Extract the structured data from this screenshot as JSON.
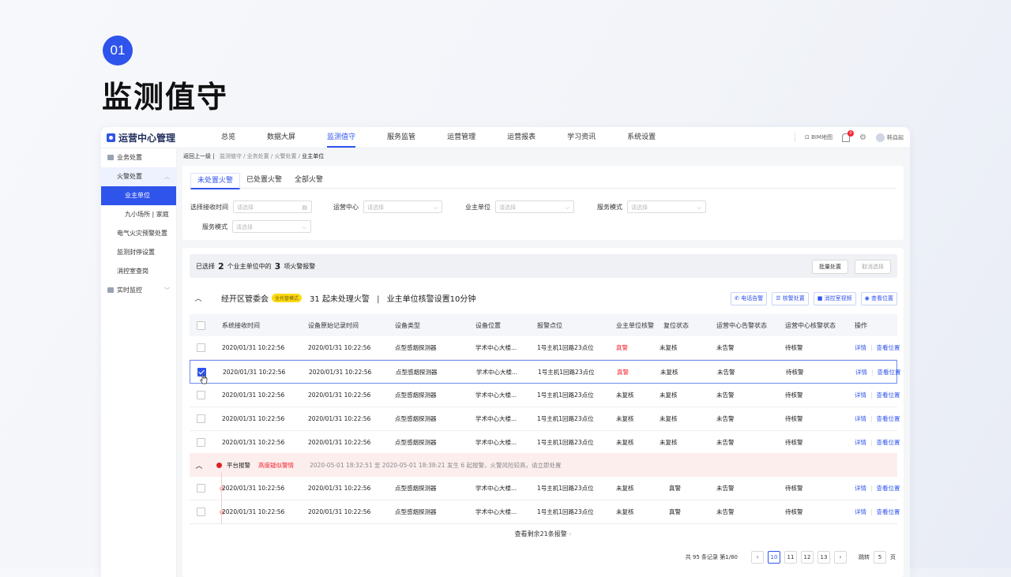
{
  "page": {
    "number": "01",
    "title": "监测值守"
  },
  "topbar": {
    "app_title": "运营中心管理",
    "nav": [
      "总览",
      "数据大屏",
      "监测值守",
      "服务监管",
      "运营管理",
      "运营报表",
      "学习资讯",
      "系统设置"
    ],
    "active_nav": "监测值守",
    "bim_label": "BIM地图",
    "notification_count": "0",
    "user_name": "韩自起"
  },
  "sidebar": {
    "items": [
      {
        "label": "业务处置"
      },
      {
        "label": "火警处置"
      },
      {
        "label": "业主单位"
      },
      {
        "label": "九小场所 | 家庭"
      },
      {
        "label": "电气火灾预警处置"
      },
      {
        "label": "监测封停设置"
      },
      {
        "label": "消控室查岗"
      },
      {
        "label": "实时监控"
      }
    ]
  },
  "breadcrumb": {
    "back": "返回上一级 |",
    "path": "监测值守 / 业务处置 / 火警处置 /",
    "current": "业主单位"
  },
  "tabs": [
    "未处置火警",
    "已处置火警",
    "全部火警"
  ],
  "filters": {
    "receive_time": {
      "label": "选择接收时间",
      "placeholder": "请选择"
    },
    "ops_center": {
      "label": "运营中心",
      "placeholder": "请选择"
    },
    "owner_unit": {
      "label": "业主单位",
      "placeholder": "请选择"
    },
    "service_mode": {
      "label": "服务模式",
      "placeholder": "请选择"
    },
    "service_mode2": {
      "label": "服务模式",
      "placeholder": "请选择"
    }
  },
  "selection": {
    "prefix": "已选择",
    "units": "2",
    "middle": "个业主单位中的",
    "items": "3",
    "suffix": "项火警报警",
    "batch_button": "批量处置",
    "cancel_button": "取消选择"
  },
  "group": {
    "org": "经开区管委会",
    "mode_tag": "全托管模式",
    "pending_count": "31",
    "pending_text": "起未处理火警",
    "divider": "|",
    "setting_text": "业主单位核警设置10分钟",
    "actions": [
      "电话告警",
      "核警处置",
      "消控室视频",
      "查看位置"
    ]
  },
  "table": {
    "headers": [
      "系统接收时间",
      "设备原始记录时间",
      "设备类型",
      "设备位置",
      "报警点位",
      "业主单位核警",
      "复位状态",
      "运营中心告警状态",
      "运营中心核警状态",
      "操作"
    ],
    "rows": [
      {
        "recv": "2020/01/31   10:22:56",
        "orig": "2020/01/31   10:22:56",
        "type": "点型感烟探测器",
        "loc": "学术中心大楼...",
        "point": "1号主机1回路23点位",
        "check": "真警",
        "reset": "未复核",
        "alarm": "未告警",
        "verify": "待核警",
        "checked": false
      },
      {
        "recv": "2020/01/31   10:22:56",
        "orig": "2020/01/31   10:22:56",
        "type": "点型感烟探测器",
        "loc": "学术中心大楼...",
        "point": "1号主机1回路23点位",
        "check": "真警",
        "reset": "未复核",
        "alarm": "未告警",
        "verify": "待核警",
        "checked": true
      },
      {
        "recv": "2020/01/31   10:22:56",
        "orig": "2020/01/31   10:22:56",
        "type": "点型感烟探测器",
        "loc": "学术中心大楼...",
        "point": "1号主机1回路23点位",
        "check": "未复核",
        "reset": "未复核",
        "alarm": "未告警",
        "verify": "待核警",
        "checked": false
      },
      {
        "recv": "2020/01/31   10:22:56",
        "orig": "2020/01/31   10:22:56",
        "type": "点型感烟探测器",
        "loc": "学术中心大楼...",
        "point": "1号主机1回路23点位",
        "check": "未复核",
        "reset": "未复核",
        "alarm": "未告警",
        "verify": "待核警",
        "checked": false
      },
      {
        "recv": "2020/01/31   10:22:56",
        "orig": "2020/01/31   10:22:56",
        "type": "点型感烟探测器",
        "loc": "学术中心大楼...",
        "point": "1号主机1回路23点位",
        "check": "未复核",
        "reset": "未复核",
        "alarm": "未告警",
        "verify": "待核警",
        "checked": false
      }
    ],
    "op_detail": "详情",
    "op_locate": "查看位置"
  },
  "platform_alarm": {
    "label": "平台报警",
    "level": "高度疑似警情",
    "message": "2020-05-01 18:32:51 至 2020-05-01 18:38:21 发生 6 起报警，火警风险较高，请立即处置"
  },
  "sub_rows": [
    {
      "recv": "2020/01/31   10:22:56",
      "orig": "2020/01/31   10:22:56",
      "type": "点型感烟探测器",
      "loc": "学术中心大楼...",
      "point": "1号主机1回路23点位",
      "check": "未复核",
      "reset": "真警",
      "alarm": "未告警",
      "verify": "待核警"
    },
    {
      "recv": "2020/01/31   10:22:56",
      "orig": "2020/01/31   10:22:56",
      "type": "点型感烟探测器",
      "loc": "学术中心大楼...",
      "point": "1号主机1回路23点位",
      "check": "未复核",
      "reset": "真警",
      "alarm": "未告警",
      "verify": "待核警"
    }
  ],
  "more": "查看剩余21条报警",
  "pagination": {
    "total": "共 95 条记录 第1/80",
    "pages": [
      "10",
      "11",
      "12",
      "13"
    ],
    "current": "10",
    "jump_label": "跳转",
    "jump_value": "5",
    "page_unit": "页"
  }
}
